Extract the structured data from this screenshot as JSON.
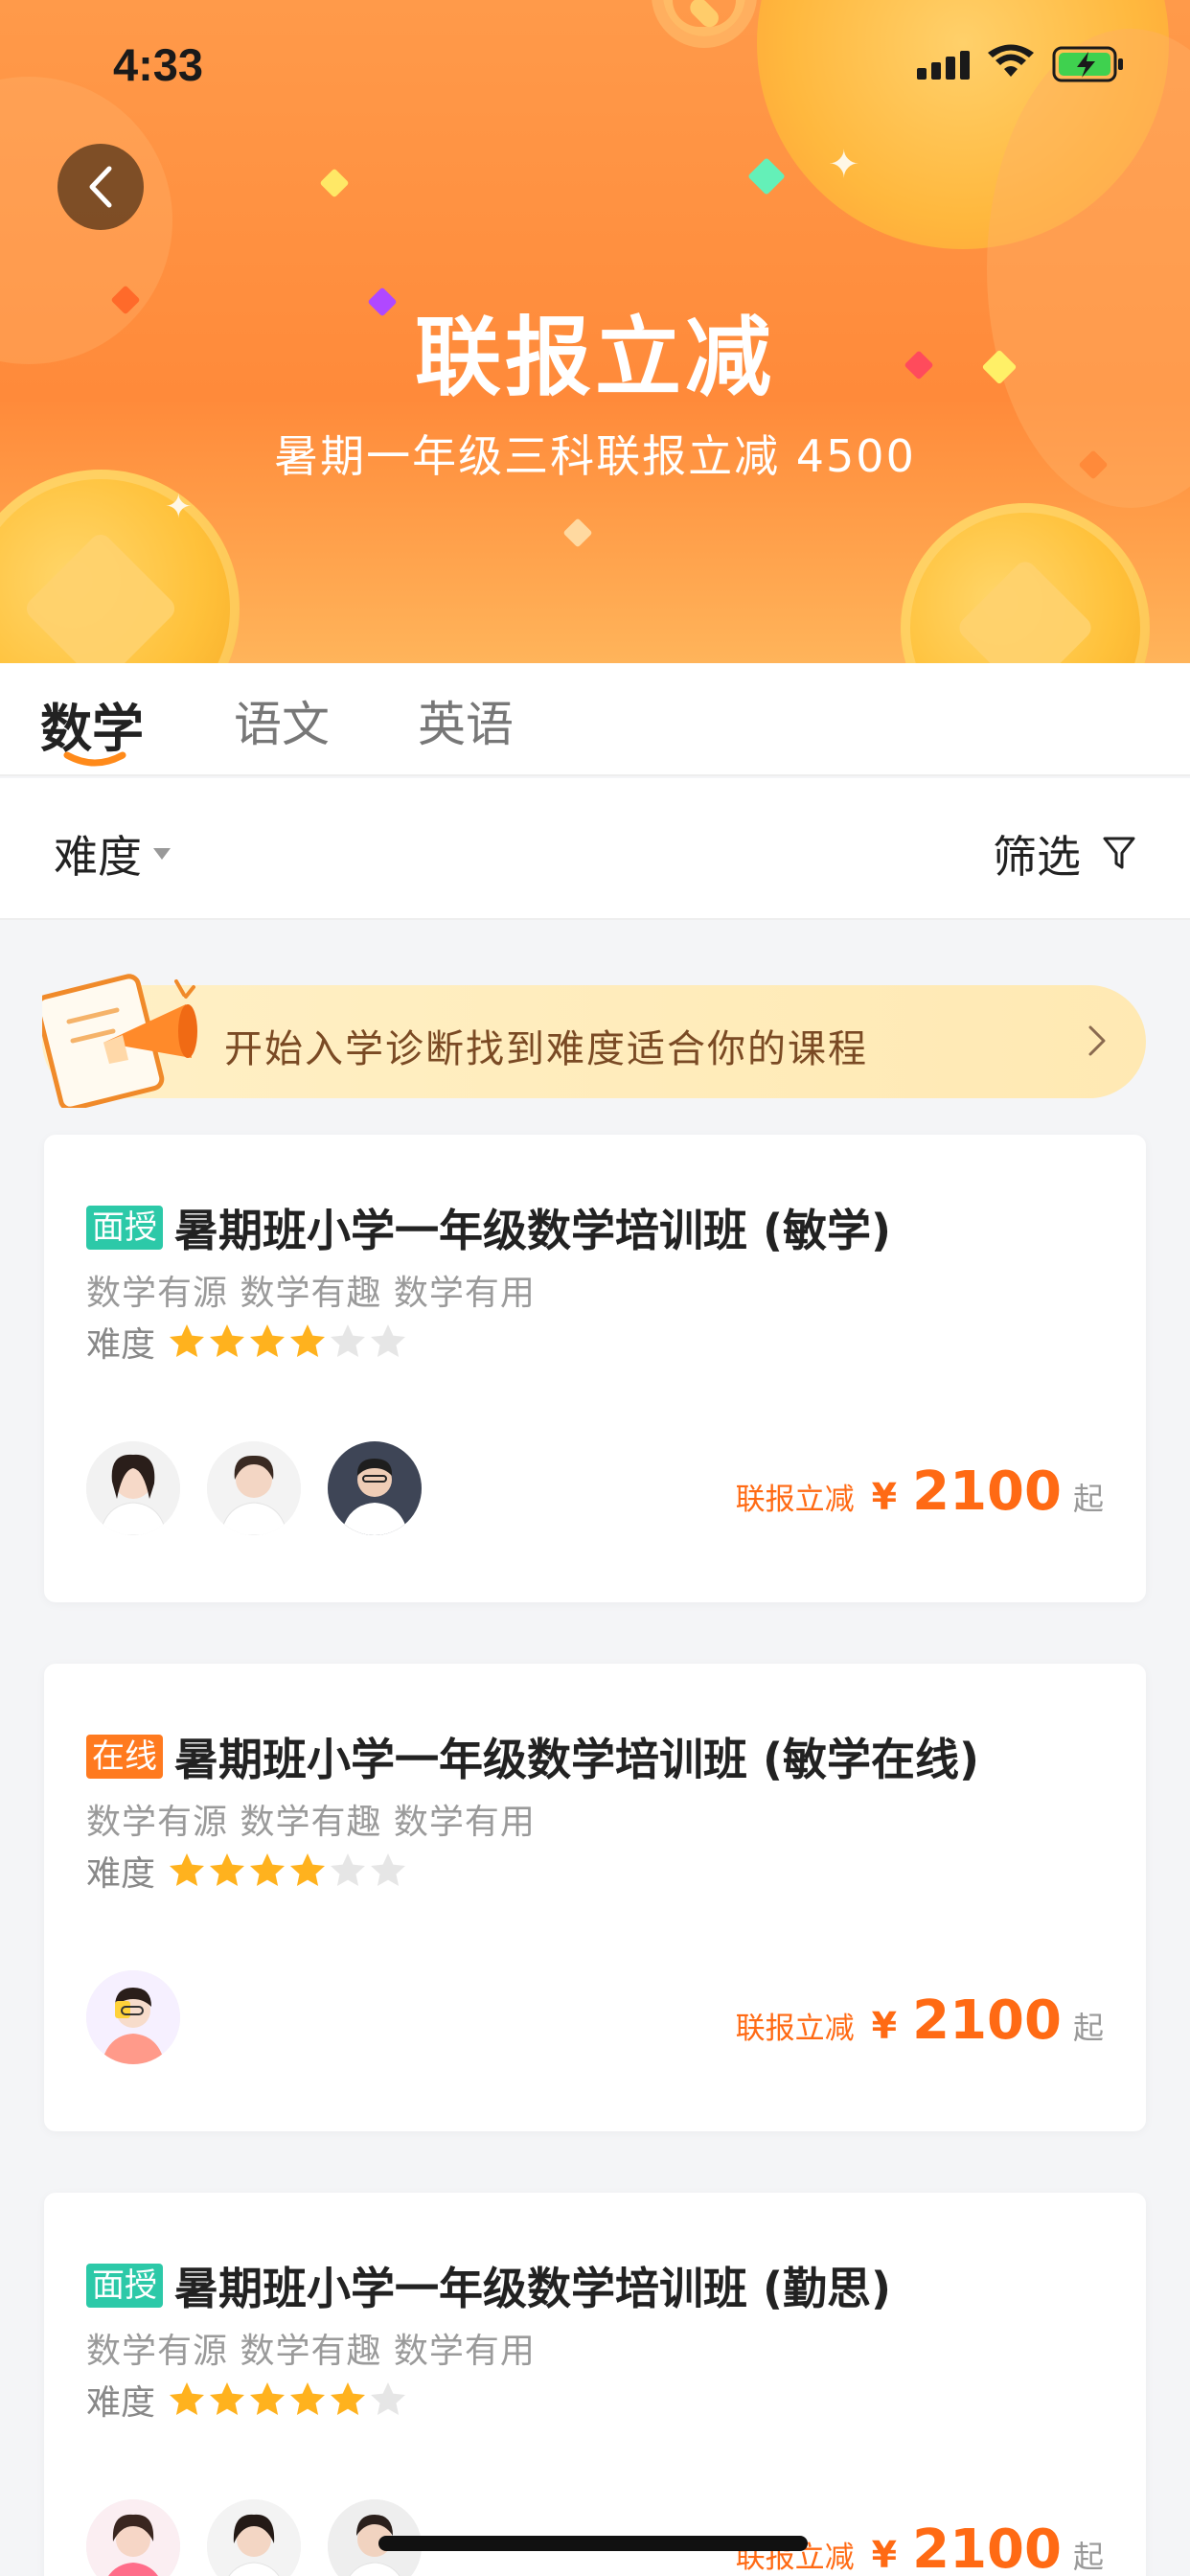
{
  "status_bar": {
    "time": "4:33"
  },
  "hero": {
    "title": "联报立减",
    "subtitle": "暑期一年级三科联报立减 4500"
  },
  "tabs": [
    {
      "label": "数学",
      "active": true
    },
    {
      "label": "语文",
      "active": false
    },
    {
      "label": "英语",
      "active": false
    }
  ],
  "filters": {
    "difficulty_label": "难度",
    "filter_label": "筛选"
  },
  "diagnosis_banner": {
    "text": "开始入学诊断找到难度适合你的课程"
  },
  "courses": [
    {
      "tag": "面授",
      "tag_color": "#2cc9a8",
      "title": "暑期班小学一年级数学培训班 (敏学)",
      "description": "数学有源 数学有趣 数学有用",
      "difficulty_label": "难度",
      "difficulty_rating": 4,
      "difficulty_max": 6,
      "teachers_count": 3,
      "price_label": "联报立减",
      "currency": "¥",
      "price": "2100",
      "price_suffix": "起"
    },
    {
      "tag": "在线",
      "tag_color": "#ff7a1f",
      "title": "暑期班小学一年级数学培训班 (敏学在线)",
      "description": "数学有源 数学有趣 数学有用",
      "difficulty_label": "难度",
      "difficulty_rating": 4,
      "difficulty_max": 6,
      "teachers_count": 1,
      "price_label": "联报立减",
      "currency": "¥",
      "price": "2100",
      "price_suffix": "起"
    },
    {
      "tag": "面授",
      "tag_color": "#2cc9a8",
      "title": "暑期班小学一年级数学培训班 (勤思)",
      "description": "数学有源 数学有趣 数学有用",
      "difficulty_label": "难度",
      "difficulty_rating": 5,
      "difficulty_max": 6,
      "teachers_count": 3,
      "price_label": "联报立减",
      "currency": "¥",
      "price": "2100",
      "price_suffix": "起"
    }
  ],
  "colors": {
    "accent": "#ff6a14",
    "star_on": "#ffb21e",
    "star_off": "#e6e6e6"
  }
}
